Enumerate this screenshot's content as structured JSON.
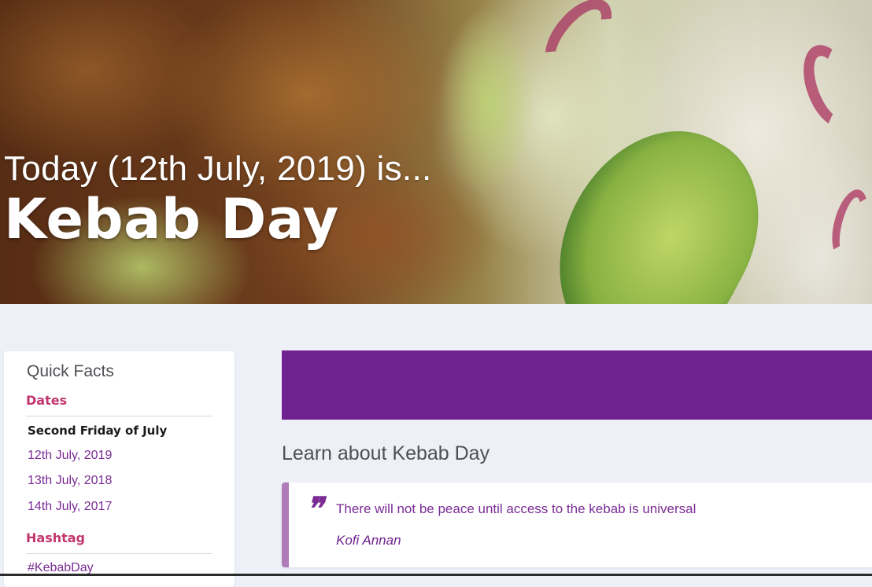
{
  "hero": {
    "subtitle": "Today (12th July, 2019) is...",
    "title": "Kebab Day"
  },
  "sidebar": {
    "title": "Quick Facts",
    "dates_heading": "Dates",
    "dates_rule": "Second Friday of July",
    "dates": [
      {
        "label": "12th July, 2019"
      },
      {
        "label": "13th July, 2018"
      },
      {
        "label": "14th July, 2017"
      }
    ],
    "hashtag_heading": "Hashtag",
    "hashtag": "#KebabDay"
  },
  "main": {
    "banner_color": "#6e218f",
    "heading": "Learn about Kebab Day",
    "quote": {
      "icon": "quote-mark-icon",
      "text": "There will not be peace until access to the kebab is universal",
      "author": "Kofi Annan"
    }
  },
  "colors": {
    "accent": "#6e218f",
    "heading_pink": "#c2366e",
    "link_purple": "#7a2c94",
    "page_bg": "#eef0f8"
  }
}
